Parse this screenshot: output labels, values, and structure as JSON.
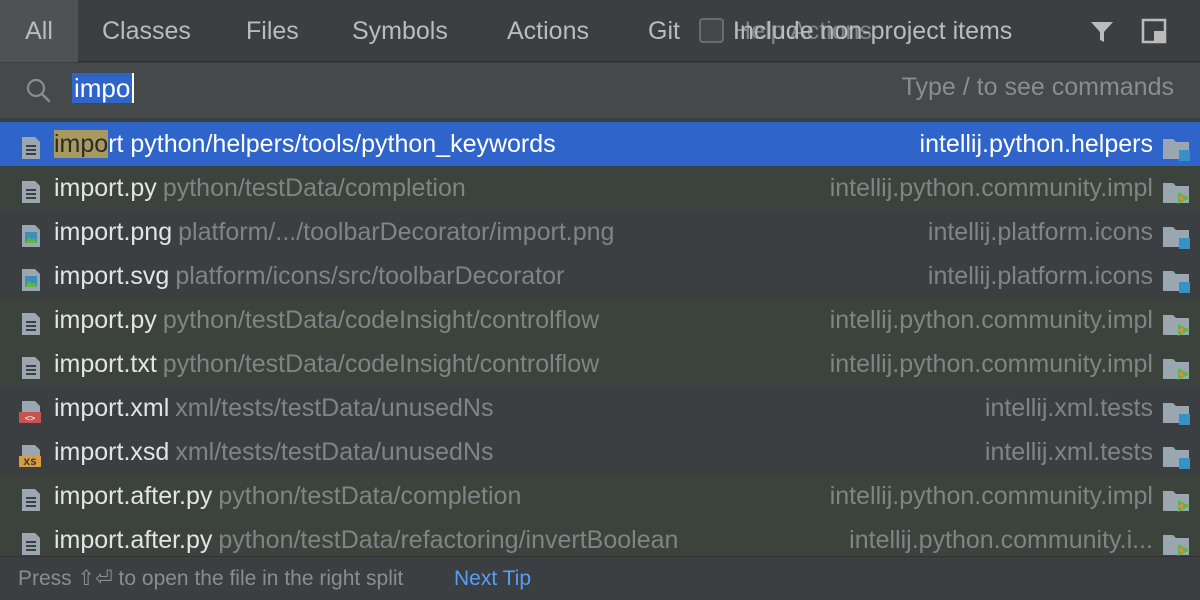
{
  "tabs": [
    {
      "label": "All",
      "active": true
    },
    {
      "label": "Classes"
    },
    {
      "label": "Files"
    },
    {
      "label": "Symbols"
    },
    {
      "label": "Actions"
    },
    {
      "label": "Git"
    }
  ],
  "git_overlay_text": "Help Actions",
  "include_non_project": {
    "label": "Include non-project items",
    "checked": false
  },
  "icons": {
    "filter": "filter-icon",
    "preview": "preview-panel-icon",
    "search": "search-icon"
  },
  "search": {
    "query": "impo",
    "hint": "Type / to see commands"
  },
  "results": [
    {
      "match": "impo",
      "rest": "rt python/helpers/tools/python_keywords",
      "path": "",
      "module": "intellij.python.helpers",
      "icon": "text-file-icon",
      "module_icon": "module-folder-icon",
      "style": "selected"
    },
    {
      "match": "",
      "rest": "import.py",
      "path": "python/testData/completion",
      "module": "intellij.python.community.impl",
      "icon": "text-file-icon",
      "module_icon": "test-folder-icon",
      "style": "green"
    },
    {
      "match": "",
      "rest": "import.png",
      "path": "platform/.../toolbarDecorator/import.png",
      "module": "intellij.platform.icons",
      "icon": "image-file-icon",
      "module_icon": "module-folder-icon",
      "style": "plain"
    },
    {
      "match": "",
      "rest": "import.svg",
      "path": "platform/icons/src/toolbarDecorator",
      "module": "intellij.platform.icons",
      "icon": "image-file-icon",
      "module_icon": "module-folder-icon",
      "style": "plain"
    },
    {
      "match": "",
      "rest": "import.py",
      "path": "python/testData/codeInsight/controlflow",
      "module": "intellij.python.community.impl",
      "icon": "text-file-icon",
      "module_icon": "test-folder-icon",
      "style": "green"
    },
    {
      "match": "",
      "rest": "import.txt",
      "path": "python/testData/codeInsight/controlflow",
      "module": "intellij.python.community.impl",
      "icon": "text-file-icon",
      "module_icon": "test-folder-icon",
      "style": "green"
    },
    {
      "match": "",
      "rest": "import.xml",
      "path": "xml/tests/testData/unusedNs",
      "module": "intellij.xml.tests",
      "icon": "xml-file-icon",
      "module_icon": "module-folder-icon",
      "style": "plain"
    },
    {
      "match": "",
      "rest": "import.xsd",
      "path": "xml/tests/testData/unusedNs",
      "module": "intellij.xml.tests",
      "icon": "xsd-file-icon",
      "module_icon": "module-folder-icon",
      "style": "plain"
    },
    {
      "match": "",
      "rest": "import.after.py",
      "path": "python/testData/completion",
      "module": "intellij.python.community.impl",
      "icon": "text-file-icon",
      "module_icon": "test-folder-icon",
      "style": "green"
    },
    {
      "match": "",
      "rest": "import.after.py",
      "path": "python/testData/refactoring/invertBoolean",
      "module": "intellij.python.community.i...",
      "icon": "text-file-icon",
      "module_icon": "test-folder-icon",
      "style": "green"
    }
  ],
  "footer": {
    "text": "Press ⇧⏎ to open the file in the right split",
    "link": "Next Tip"
  },
  "colors": {
    "background": "#3c3f41",
    "selection": "#2f65ca",
    "test_row": "#3b433c",
    "link": "#589df6"
  }
}
